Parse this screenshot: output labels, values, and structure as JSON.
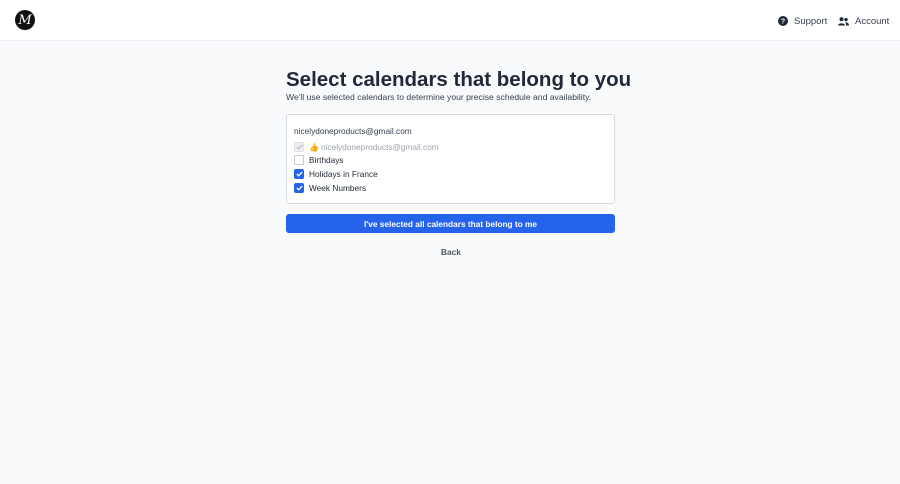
{
  "header": {
    "logo_letter": "M",
    "support_label": "Support",
    "support_icon": "help-circle-icon",
    "account_label": "Account",
    "account_icon": "users-icon"
  },
  "main": {
    "title": "Select calendars that belong to you",
    "subtitle": "We'll use selected calendars to determine your precise schedule and availability.",
    "account_email": "nicelydoneproducts@gmail.com",
    "calendars": [
      {
        "label": "nicelydoneproducts@gmail.com",
        "prefix_icon": "thumbs-up-emoji",
        "checked": true,
        "disabled": true
      },
      {
        "label": "Birthdays",
        "checked": false,
        "disabled": false
      },
      {
        "label": "Holidays in France",
        "checked": true,
        "disabled": false
      },
      {
        "label": "Week Numbers",
        "checked": true,
        "disabled": false
      }
    ],
    "confirm_button": "I've selected all calendars that belong to me",
    "back_link": "Back"
  },
  "colors": {
    "accent": "#2563eb",
    "background": "#f9fafb",
    "text": "#1f2937"
  }
}
